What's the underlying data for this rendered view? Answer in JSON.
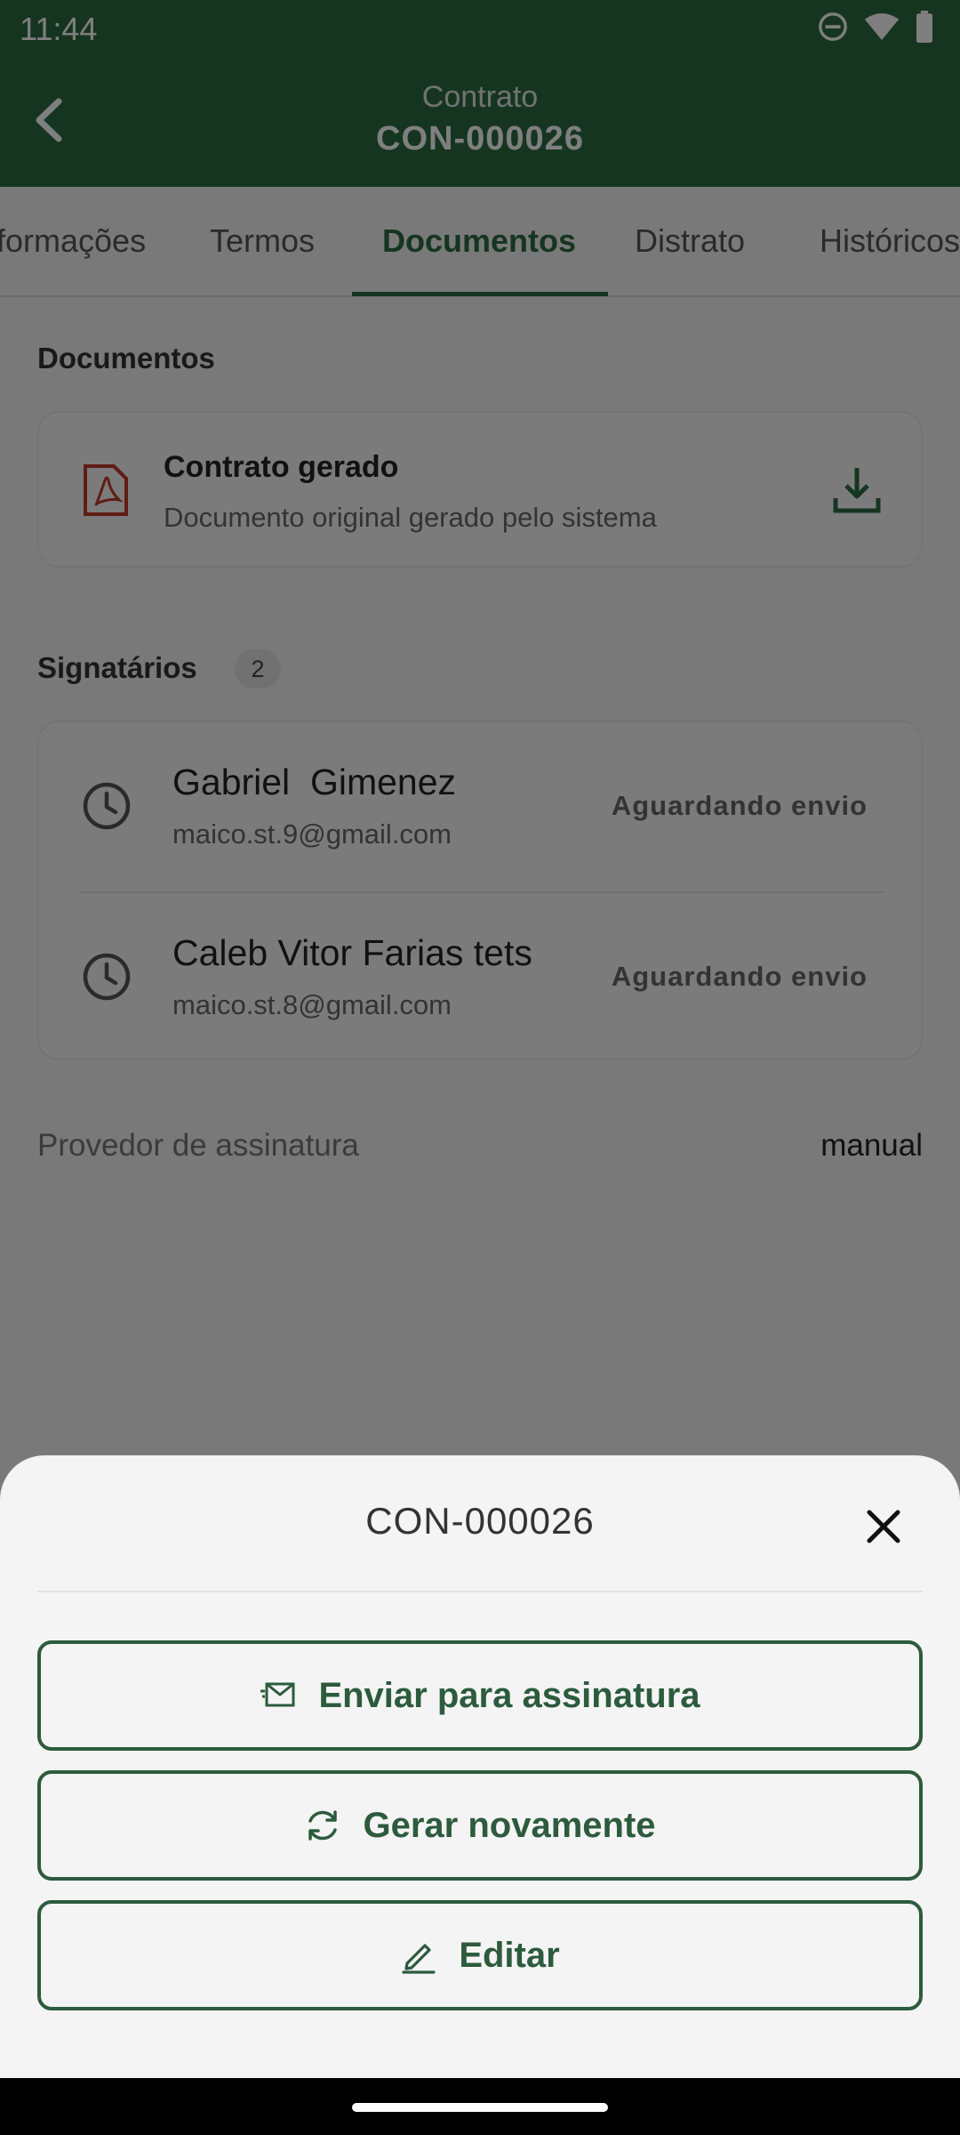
{
  "status_bar": {
    "time": "11:44",
    "icons": [
      "do-not-disturb-icon",
      "wifi-icon",
      "battery-icon"
    ]
  },
  "header": {
    "subtitle": "Contrato",
    "title": "CON-000026",
    "back_icon": "chevron-left-icon"
  },
  "tabs": [
    {
      "label": "formações",
      "active": false
    },
    {
      "label": "Termos",
      "active": false
    },
    {
      "label": "Documentos",
      "active": true
    },
    {
      "label": "Distrato",
      "active": false
    },
    {
      "label": "Históricos",
      "active": false
    }
  ],
  "documents": {
    "section_title": "Documentos",
    "item": {
      "title": "Contrato gerado",
      "subtitle": "Documento original gerado pelo sistema",
      "icon": "pdf-icon",
      "action_icon": "download-icon"
    }
  },
  "signers": {
    "section_title": "Signatários",
    "count": "2",
    "items": [
      {
        "name": "Gabriel  Gimenez",
        "email": "maico.st.9@gmail.com",
        "status": "Aguardando envio",
        "icon": "clock-icon"
      },
      {
        "name": "Caleb Vitor Farias tets",
        "email": "maico.st.8@gmail.com",
        "status": "Aguardando envio",
        "icon": "clock-icon"
      }
    ]
  },
  "provider": {
    "label": "Provedor de assinatura",
    "value": "manual"
  },
  "sheet": {
    "title": "CON-000026",
    "close_icon": "close-icon",
    "actions": [
      {
        "label": "Enviar para assinatura",
        "icon": "send-mail-icon"
      },
      {
        "label": "Gerar novamente",
        "icon": "refresh-icon"
      },
      {
        "label": "Editar",
        "icon": "pencil-icon"
      }
    ]
  },
  "colors": {
    "brand_green": "#2c6b43",
    "button_green": "#2c5b3d",
    "pdf_red": "#c0392b"
  }
}
